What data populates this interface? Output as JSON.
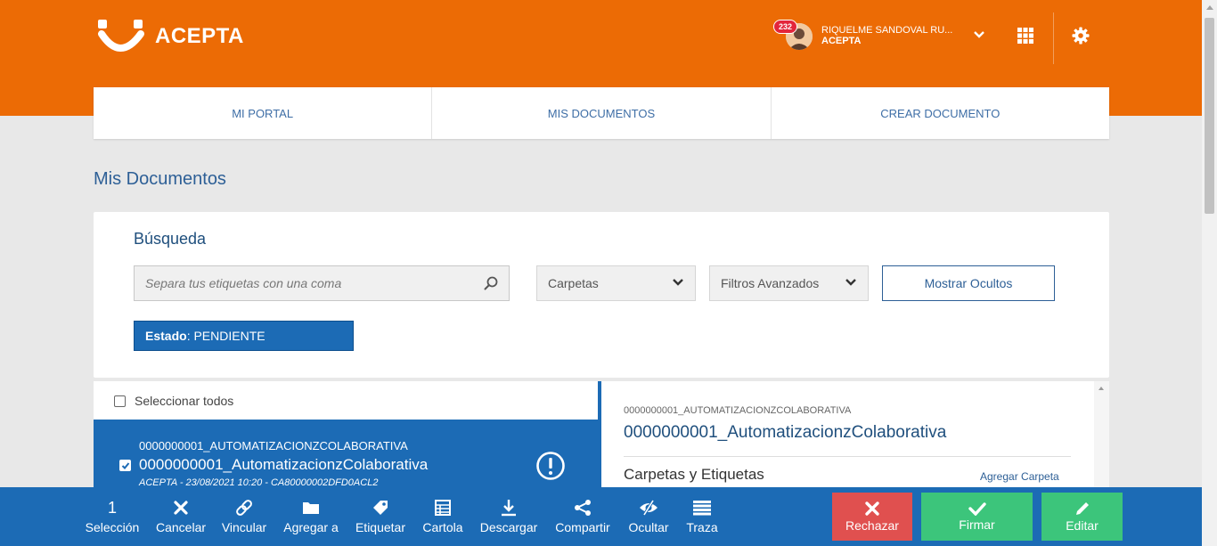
{
  "header": {
    "brand": "ACEPTA",
    "notifications_count": "232",
    "user_name": "RIQUELME SANDOVAL RU...",
    "user_org": "ACEPTA",
    "icons": [
      "user-avatar-icon",
      "chevron-down-icon",
      "apps-grid-icon",
      "gear-icon"
    ]
  },
  "nav": {
    "tabs": [
      {
        "label": "MI PORTAL"
      },
      {
        "label": "MIS DOCUMENTOS"
      },
      {
        "label": "CREAR DOCUMENTO"
      }
    ]
  },
  "page": {
    "title": "Mis Documentos"
  },
  "search": {
    "title": "Búsqueda",
    "placeholder": "Separa tus etiquetas con una coma",
    "value": "",
    "carpetas": "Carpetas",
    "filtros": "Filtros Avanzados",
    "mostrar_ocultos": "Mostrar Ocultos",
    "estado_key": "Estado",
    "estado_value": ": PENDIENTE"
  },
  "list": {
    "select_all": "Seleccionar todos",
    "items": [
      {
        "id": "0000000001_AUTOMATIZACIONZCOLABORATIVA",
        "name": "0000000001_AutomatizacionzColaborativa",
        "meta": "ACEPTA - 23/08/2021 10:20 - CA80000002DFD0ACL2",
        "checked": true
      }
    ]
  },
  "detail": {
    "id": "0000000001_AUTOMATIZACIONZCOLABORATIVA",
    "name": "0000000001_AutomatizacionzColaborativa",
    "section_title": "Carpetas y Etiquetas",
    "add_folder": "Agregar Carpeta"
  },
  "toolbar": {
    "selection_count": "1",
    "selection_label": "Selección",
    "cancelar": "Cancelar",
    "vincular": "Vincular",
    "agregar_a": "Agregar a",
    "etiquetar": "Etiquetar",
    "cartola": "Cartola",
    "descargar": "Descargar",
    "compartir": "Compartir",
    "ocultar": "Ocultar",
    "traza": "Traza",
    "rechazar": "Rechazar",
    "firmar": "Firmar",
    "editar": "Editar"
  },
  "colors": {
    "brand_orange": "#ec6b05",
    "primary_blue": "#1c6bb5",
    "reject_red": "#e0504f",
    "accept_green": "#3cc57b"
  }
}
